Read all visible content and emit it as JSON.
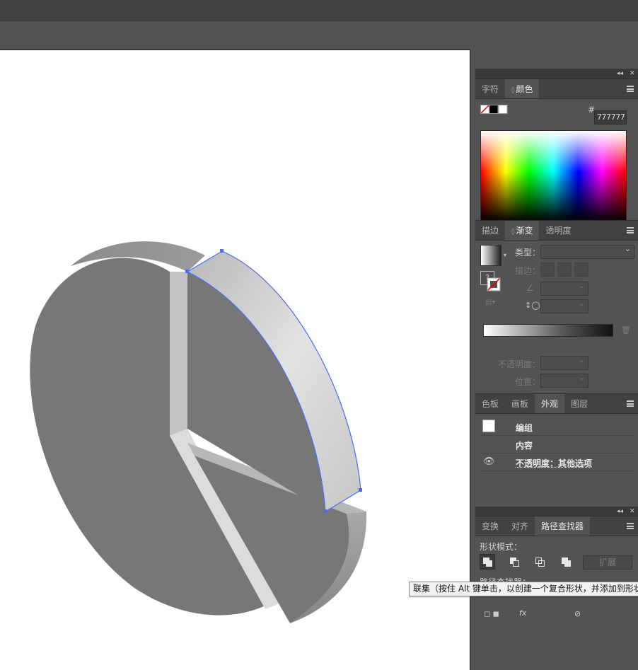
{
  "color_panel": {
    "tabs": [
      "字符",
      "颜色"
    ],
    "active_tab": "颜色",
    "hex_label": "#",
    "hex_value": "777777"
  },
  "gradient_panel": {
    "tabs": [
      "描边",
      "渐变",
      "透明度"
    ],
    "active_tab": "渐变",
    "type_label": "类型：",
    "type_value": "",
    "stroke_label": "描边：",
    "opacity_label": "不透明度：",
    "position_label": "位置："
  },
  "appearance_panel": {
    "tabs": [
      "色板",
      "画板",
      "外观",
      "图层"
    ],
    "active_tab": "外观",
    "rows": [
      "编组",
      "内容",
      "不透明度：其他选项"
    ]
  },
  "pathfinder_panel": {
    "tabs": [
      "变换",
      "对齐",
      "路径查找器"
    ],
    "active_tab": "路径查找器",
    "shape_modes_label": "形状模式：",
    "expand_label": "扩展",
    "pathfinders_label": "路径查找器："
  },
  "tooltip": {
    "text": "联集（按住 Alt 键单击，以创建一个复合形状，并添加到形状"
  },
  "colors": {
    "selection_blue": "#4a6cf7",
    "fill": "#777777"
  }
}
